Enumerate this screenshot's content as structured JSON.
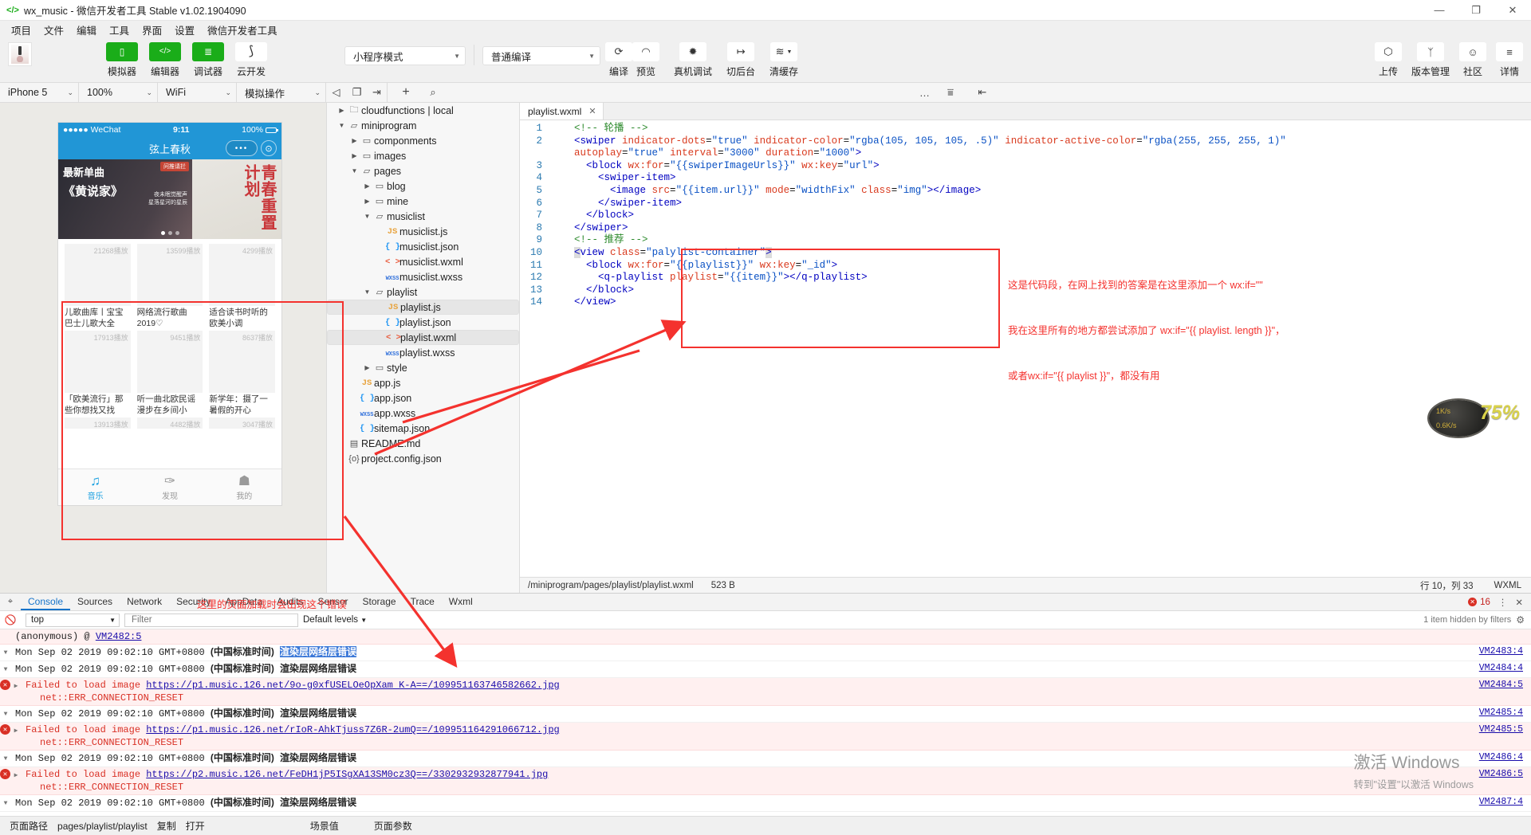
{
  "window": {
    "title": "wx_music - 微信开发者工具 Stable v1.02.1904090",
    "logo": "</>",
    "minimize": "—",
    "maximize": "❐",
    "close": "✕"
  },
  "menubar": {
    "items": [
      "项目",
      "文件",
      "编辑",
      "工具",
      "界面",
      "设置",
      "微信开发者工具"
    ]
  },
  "toolbar": {
    "left_buttons": [
      {
        "label": "模拟器",
        "icon": "phone-icon",
        "glyph": "▯"
      },
      {
        "label": "编辑器",
        "icon": "code-icon",
        "glyph": "</>"
      },
      {
        "label": "调试器",
        "icon": "debug-icon",
        "glyph": "≣"
      },
      {
        "label": "云开发",
        "icon": "cloud-dev-icon",
        "glyph": "⟆"
      }
    ],
    "mode_select": "小程序模式",
    "compile_select": "普通编译",
    "center_buttons": [
      {
        "label": "编译",
        "icon": "refresh-icon",
        "glyph": "⟳"
      },
      {
        "label": "预览",
        "icon": "eye-icon",
        "glyph": "◠"
      },
      {
        "label": "真机调试",
        "icon": "bug-icon",
        "glyph": "✹"
      },
      {
        "label": "切后台",
        "icon": "background-icon",
        "glyph": "↦"
      },
      {
        "label": "清缓存",
        "icon": "layers-icon",
        "glyph": "≋"
      }
    ],
    "right_buttons": [
      {
        "label": "上传",
        "icon": "upload-cloud-icon",
        "glyph": "⬡"
      },
      {
        "label": "版本管理",
        "icon": "branch-icon",
        "glyph": "ᛉ"
      },
      {
        "label": "社区",
        "icon": "chat-icon",
        "glyph": "☺"
      },
      {
        "label": "详情",
        "icon": "hamburger-icon",
        "glyph": "≡"
      }
    ]
  },
  "subbar": {
    "device": "iPhone 5",
    "zoom": "100%",
    "network": "WiFi",
    "simulate": "模拟操作",
    "icons": [
      "mute-icon",
      "rotate-icon",
      "screenshot-icon",
      "add-icon",
      "search-icon",
      "more-icon",
      "sort-icon",
      "panel-icon"
    ]
  },
  "simulator": {
    "status": {
      "carrier": "●●●●● WeChat",
      "wifi": "令",
      "time": "9:11",
      "battery": "100%"
    },
    "nav_title": "弦上春秋",
    "nav_more": "•••",
    "nav_circle": "⊙",
    "banner": {
      "left_text": "最新单曲\n《黄说家》",
      "left_sub": "夜未眠觉醒声\n星落星河的星辰",
      "ad_label": "问推请拦",
      "right_text": "青春重置计划"
    },
    "playlists": [
      {
        "count": "21268播放",
        "title": "儿歌曲库丨宝宝巴士儿歌大全"
      },
      {
        "count": "13599播放",
        "title": "网络流行歌曲2019♡"
      },
      {
        "count": "4299播放",
        "title": "适合读书时听的欧美小调"
      },
      {
        "count": "17913播放",
        "title": "「欧美流行」那些你想找又找不…"
      },
      {
        "count": "9451播放",
        "title": "听一曲北欧民谣 漫步在乡间小路…"
      },
      {
        "count": "8637播放",
        "title": "新学年：摄了一暑假的开心事，…"
      },
      {
        "count": "13913播放",
        "title": ""
      },
      {
        "count": "4482播放",
        "title": ""
      },
      {
        "count": "3047播放",
        "title": ""
      }
    ],
    "tabbar": [
      {
        "label": "音乐",
        "icon": "music-note-icon",
        "glyph": "♫",
        "active": true
      },
      {
        "label": "发现",
        "icon": "discover-icon",
        "glyph": "✑",
        "active": false
      },
      {
        "label": "我的",
        "icon": "user-icon",
        "glyph": "☗",
        "active": false
      }
    ]
  },
  "filetree": [
    {
      "depth": 0,
      "twisty": "▶",
      "icon": "cloud-folder-icon",
      "label": "cloudfunctions | local",
      "selected": false
    },
    {
      "depth": 0,
      "twisty": "▼",
      "icon": "folder-open-icon",
      "label": "miniprogram",
      "selected": false
    },
    {
      "depth": 1,
      "twisty": "▶",
      "icon": "folder-icon",
      "label": "componments",
      "selected": false
    },
    {
      "depth": 1,
      "twisty": "▶",
      "icon": "folder-icon",
      "label": "images",
      "selected": false
    },
    {
      "depth": 1,
      "twisty": "▼",
      "icon": "folder-open-icon",
      "label": "pages",
      "selected": false
    },
    {
      "depth": 2,
      "twisty": "▶",
      "icon": "folder-icon",
      "label": "blog",
      "selected": false
    },
    {
      "depth": 2,
      "twisty": "▶",
      "icon": "folder-icon",
      "label": "mine",
      "selected": false
    },
    {
      "depth": 2,
      "twisty": "▼",
      "icon": "folder-open-icon",
      "label": "musiclist",
      "selected": false
    },
    {
      "depth": 3,
      "twisty": "",
      "icon": "js-file-icon",
      "label": "musiclist.js",
      "selected": false
    },
    {
      "depth": 3,
      "twisty": "",
      "icon": "json-file-icon",
      "label": "musiclist.json",
      "selected": false
    },
    {
      "depth": 3,
      "twisty": "",
      "icon": "wxml-file-icon",
      "label": "musiclist.wxml",
      "selected": false
    },
    {
      "depth": 3,
      "twisty": "",
      "icon": "wxss-file-icon",
      "label": "musiclist.wxss",
      "selected": false
    },
    {
      "depth": 2,
      "twisty": "▼",
      "icon": "folder-open-icon",
      "label": "playlist",
      "selected": false
    },
    {
      "depth": 3,
      "twisty": "",
      "icon": "js-file-icon",
      "label": "playlist.js",
      "selected": true
    },
    {
      "depth": 3,
      "twisty": "",
      "icon": "json-file-icon",
      "label": "playlist.json",
      "selected": false
    },
    {
      "depth": 3,
      "twisty": "",
      "icon": "wxml-file-icon",
      "label": "playlist.wxml",
      "selected": true
    },
    {
      "depth": 3,
      "twisty": "",
      "icon": "wxss-file-icon",
      "label": "playlist.wxss",
      "selected": false
    },
    {
      "depth": 2,
      "twisty": "▶",
      "icon": "folder-icon",
      "label": "style",
      "selected": false
    },
    {
      "depth": 1,
      "twisty": "",
      "icon": "js-file-icon",
      "label": "app.js",
      "selected": false
    },
    {
      "depth": 1,
      "twisty": "",
      "icon": "json-file-icon",
      "label": "app.json",
      "selected": false
    },
    {
      "depth": 1,
      "twisty": "",
      "icon": "wxss-file-icon",
      "label": "app.wxss",
      "selected": false
    },
    {
      "depth": 1,
      "twisty": "",
      "icon": "json-file-icon",
      "label": "sitemap.json",
      "selected": false
    },
    {
      "depth": 0,
      "twisty": "",
      "icon": "markdown-file-icon",
      "label": "README.md",
      "selected": false
    },
    {
      "depth": 0,
      "twisty": "",
      "icon": "config-file-icon",
      "label": "project.config.json",
      "selected": false
    }
  ],
  "editor": {
    "tab": {
      "label": "playlist.wxml",
      "close": "✕"
    },
    "lines": [
      {
        "n": "1",
        "segs": [
          {
            "t": "    ",
            "c": "p"
          },
          {
            "t": "<!-- 轮播 -->",
            "c": "cmt"
          }
        ]
      },
      {
        "n": "2",
        "segs": [
          {
            "t": "    ",
            "c": "p"
          },
          {
            "t": "<swiper ",
            "c": "tag"
          },
          {
            "t": "indicator-dots",
            "c": "attr"
          },
          {
            "t": "=",
            "c": "p"
          },
          {
            "t": "\"true\"",
            "c": "str"
          },
          {
            "t": " ",
            "c": "p"
          },
          {
            "t": "indicator-color",
            "c": "attr"
          },
          {
            "t": "=",
            "c": "p"
          },
          {
            "t": "\"rgba(105, 105, 105, .5)\"",
            "c": "str"
          },
          {
            "t": " ",
            "c": "p"
          },
          {
            "t": "indicator-active-color",
            "c": "attr"
          },
          {
            "t": "=",
            "c": "p"
          },
          {
            "t": "\"rgba(255, 255, 255, 1)\"",
            "c": "str"
          }
        ]
      },
      {
        "n": "",
        "segs": [
          {
            "t": "    ",
            "c": "p"
          },
          {
            "t": "autoplay",
            "c": "attr"
          },
          {
            "t": "=",
            "c": "p"
          },
          {
            "t": "\"true\"",
            "c": "str"
          },
          {
            "t": " ",
            "c": "p"
          },
          {
            "t": "interval",
            "c": "attr"
          },
          {
            "t": "=",
            "c": "p"
          },
          {
            "t": "\"3000\"",
            "c": "str"
          },
          {
            "t": " ",
            "c": "p"
          },
          {
            "t": "duration",
            "c": "attr"
          },
          {
            "t": "=",
            "c": "p"
          },
          {
            "t": "\"1000\"",
            "c": "str"
          },
          {
            "t": ">",
            "c": "tag"
          }
        ]
      },
      {
        "n": "3",
        "segs": [
          {
            "t": "      ",
            "c": "p"
          },
          {
            "t": "<block ",
            "c": "tag"
          },
          {
            "t": "wx:for",
            "c": "attr"
          },
          {
            "t": "=",
            "c": "p"
          },
          {
            "t": "\"{{swiperImageUrls}}\"",
            "c": "str"
          },
          {
            "t": " ",
            "c": "p"
          },
          {
            "t": "wx:key",
            "c": "attr"
          },
          {
            "t": "=",
            "c": "p"
          },
          {
            "t": "\"url\"",
            "c": "str"
          },
          {
            "t": ">",
            "c": "tag"
          }
        ]
      },
      {
        "n": "4",
        "segs": [
          {
            "t": "        ",
            "c": "p"
          },
          {
            "t": "<swiper-item>",
            "c": "tag"
          }
        ]
      },
      {
        "n": "5",
        "segs": [
          {
            "t": "          ",
            "c": "p"
          },
          {
            "t": "<image ",
            "c": "tag"
          },
          {
            "t": "src",
            "c": "attr"
          },
          {
            "t": "=",
            "c": "p"
          },
          {
            "t": "\"{{item.url}}\"",
            "c": "str"
          },
          {
            "t": " ",
            "c": "p"
          },
          {
            "t": "mode",
            "c": "attr"
          },
          {
            "t": "=",
            "c": "p"
          },
          {
            "t": "\"widthFix\"",
            "c": "str"
          },
          {
            "t": " ",
            "c": "p"
          },
          {
            "t": "class",
            "c": "attr"
          },
          {
            "t": "=",
            "c": "p"
          },
          {
            "t": "\"img\"",
            "c": "str"
          },
          {
            "t": "></image>",
            "c": "tag"
          }
        ]
      },
      {
        "n": "6",
        "segs": [
          {
            "t": "        ",
            "c": "p"
          },
          {
            "t": "</swiper-item>",
            "c": "tag"
          }
        ]
      },
      {
        "n": "7",
        "segs": [
          {
            "t": "      ",
            "c": "p"
          },
          {
            "t": "</block>",
            "c": "tag"
          }
        ]
      },
      {
        "n": "8",
        "segs": [
          {
            "t": "    ",
            "c": "p"
          },
          {
            "t": "</swiper>",
            "c": "tag"
          }
        ]
      },
      {
        "n": "9",
        "segs": [
          {
            "t": "    ",
            "c": "p"
          },
          {
            "t": "<!-- 推荐 -->",
            "c": "cmt"
          }
        ]
      },
      {
        "n": "10",
        "segs": [
          {
            "t": "    ",
            "c": "p"
          },
          {
            "t": "<",
            "c": "hlsel"
          },
          {
            "t": "view ",
            "c": "tag"
          },
          {
            "t": "class",
            "c": "attr"
          },
          {
            "t": "=",
            "c": "p"
          },
          {
            "t": "\"palylist-container\"",
            "c": "str"
          },
          {
            "t": ">",
            "c": "hlsel"
          }
        ]
      },
      {
        "n": "11",
        "segs": [
          {
            "t": "      ",
            "c": "p"
          },
          {
            "t": "<block ",
            "c": "tag"
          },
          {
            "t": "wx:for",
            "c": "attr"
          },
          {
            "t": "=",
            "c": "p"
          },
          {
            "t": "\"{{playlist}}\"",
            "c": "str"
          },
          {
            "t": " ",
            "c": "p"
          },
          {
            "t": "wx:key",
            "c": "attr"
          },
          {
            "t": "=",
            "c": "p"
          },
          {
            "t": "\"_id\"",
            "c": "str"
          },
          {
            "t": ">",
            "c": "tag"
          }
        ]
      },
      {
        "n": "12",
        "segs": [
          {
            "t": "        ",
            "c": "p"
          },
          {
            "t": "<q-playlist ",
            "c": "tag"
          },
          {
            "t": "playlist",
            "c": "attr"
          },
          {
            "t": "=",
            "c": "p"
          },
          {
            "t": "\"{{item}}\"",
            "c": "str"
          },
          {
            "t": "></q-playlist>",
            "c": "tag"
          }
        ]
      },
      {
        "n": "13",
        "segs": [
          {
            "t": "      ",
            "c": "p"
          },
          {
            "t": "</block>",
            "c": "tag"
          }
        ]
      },
      {
        "n": "14",
        "segs": [
          {
            "t": "    ",
            "c": "p"
          },
          {
            "t": "</view>",
            "c": "tag"
          }
        ]
      }
    ],
    "statusbar": {
      "path": "/miniprogram/pages/playlist/playlist.wxml",
      "size": "523 B",
      "position": "行 10，列 33",
      "language": "WXML"
    }
  },
  "annotations": {
    "code_note_line1": "这是代码段，在网上找到的答案是在这里添加一个 wx:if=\"\"",
    "code_note_line2": "我在这里所有的地方都尝试添加了 wx:if=\"{{ playlist. length }}\"，",
    "code_note_line3": "或者wx:if=\"{{ playlist }}\"，都没有用",
    "simulator_note": "这里的页面加载时会出现这个错误"
  },
  "devtools": {
    "tabs": [
      "Console",
      "Sources",
      "Network",
      "Security",
      "AppData",
      "Audits",
      "Sensor",
      "Storage",
      "Trace",
      "Wxml"
    ],
    "active_tab": "Console",
    "error_count": "16",
    "more_icon": "⋮",
    "close_icon": "✕",
    "context": "top",
    "filter_placeholder": "Filter",
    "levels": "Default levels",
    "hidden_note": "1 item hidden by filters",
    "messages": [
      {
        "type": "stack",
        "text": "(anonymous) @ ",
        "link": "VM2482:5",
        "src": ""
      },
      {
        "type": "log",
        "time": "Mon Sep 02 2019 09:02:10 GMT+0800",
        "zone": "(中国标准时间)",
        "tag": "渲染层网络层错误",
        "highlighted": true,
        "src": "VM2483:4"
      },
      {
        "type": "log",
        "time": "Mon Sep 02 2019 09:02:10 GMT+0800",
        "zone": "(中国标准时间)",
        "tag": "渲染层网络层错误",
        "highlighted": false,
        "src": "VM2484:4"
      },
      {
        "type": "error",
        "text": "Failed to load image ",
        "url": "https://p1.music.126.net/9o-g0xfUSELOeOpXam K-A==/109951163746582662.jpg",
        "detail": "net::ERR_CONNECTION_RESET",
        "src": "VM2484:5"
      },
      {
        "type": "log",
        "time": "Mon Sep 02 2019 09:02:10 GMT+0800",
        "zone": "(中国标准时间)",
        "tag": "渲染层网络层错误",
        "highlighted": false,
        "src": "VM2485:4"
      },
      {
        "type": "error",
        "text": "Failed to load image ",
        "url": "https://p1.music.126.net/rIoR-AhkTjuss7Z6R-2umQ==/109951164291066712.jpg",
        "detail": "net::ERR_CONNECTION_RESET",
        "src": "VM2485:5"
      },
      {
        "type": "log",
        "time": "Mon Sep 02 2019 09:02:10 GMT+0800",
        "zone": "(中国标准时间)",
        "tag": "渲染层网络层错误",
        "highlighted": false,
        "src": "VM2486:4"
      },
      {
        "type": "error",
        "text": "Failed to load image ",
        "url": "https://p2.music.126.net/FeDH1jP5ISgXA13SM0cz3Q==/3302932932877941.jpg",
        "detail": "net::ERR_CONNECTION_RESET",
        "src": "VM2486:5"
      },
      {
        "type": "log",
        "time": "Mon Sep 02 2019 09:02:10 GMT+0800",
        "zone": "(中国标准时间)",
        "tag": "渲染层网络层错误",
        "highlighted": false,
        "src": "VM2487:4"
      }
    ]
  },
  "statusbar": {
    "label": "页面路径",
    "path": "pages/playlist/playlist",
    "copy": "复制",
    "open": "打开",
    "scene": "场景值",
    "params": "页面参数"
  },
  "watermark": {
    "line1": "激活 Windows",
    "line2": "转到\"设置\"以激活 Windows",
    "badge_percent": "75%",
    "badge_top": "1K/s",
    "badge_bottom": "0.6K/s"
  }
}
